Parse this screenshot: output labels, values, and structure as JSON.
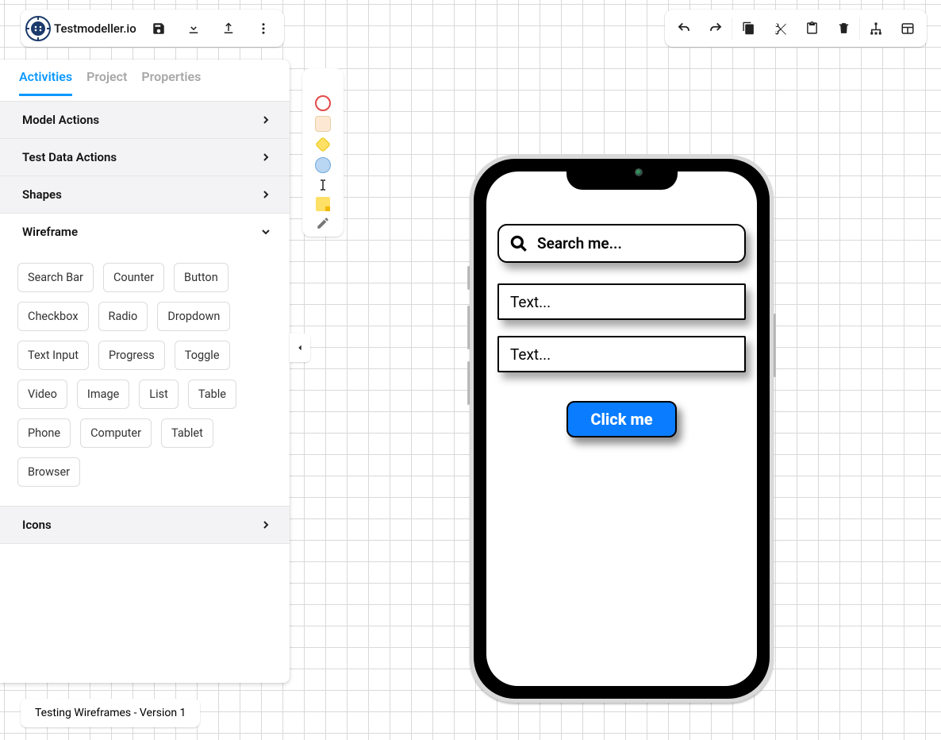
{
  "brand": {
    "name": "Testmodeller.io"
  },
  "left_panel": {
    "tabs": [
      {
        "label": "Activities",
        "active": true
      },
      {
        "label": "Project",
        "active": false
      },
      {
        "label": "Properties",
        "active": false
      }
    ],
    "sections": {
      "model_actions": "Model Actions",
      "test_data_actions": "Test Data Actions",
      "shapes": "Shapes",
      "wireframe": "Wireframe",
      "icons": "Icons"
    },
    "wireframe_items": [
      "Search Bar",
      "Counter",
      "Button",
      "Checkbox",
      "Radio",
      "Dropdown",
      "Text Input",
      "Progress",
      "Toggle",
      "Video",
      "Image",
      "List",
      "Table",
      "Phone",
      "Computer",
      "Tablet",
      "Browser"
    ]
  },
  "model_tools": {
    "colors": {
      "green": "#a4e88b",
      "red_border": "#e34a4a",
      "beige": "#fde9d3",
      "yellow": "#ffe066",
      "blue": "#b9d6f2"
    }
  },
  "wireframe_canvas": {
    "search_placeholder": "Search me...",
    "text_input_1": "Text...",
    "text_input_2": "Text...",
    "button_label": "Click me"
  },
  "document": {
    "title": "Testing Wireframes - Version 1"
  }
}
